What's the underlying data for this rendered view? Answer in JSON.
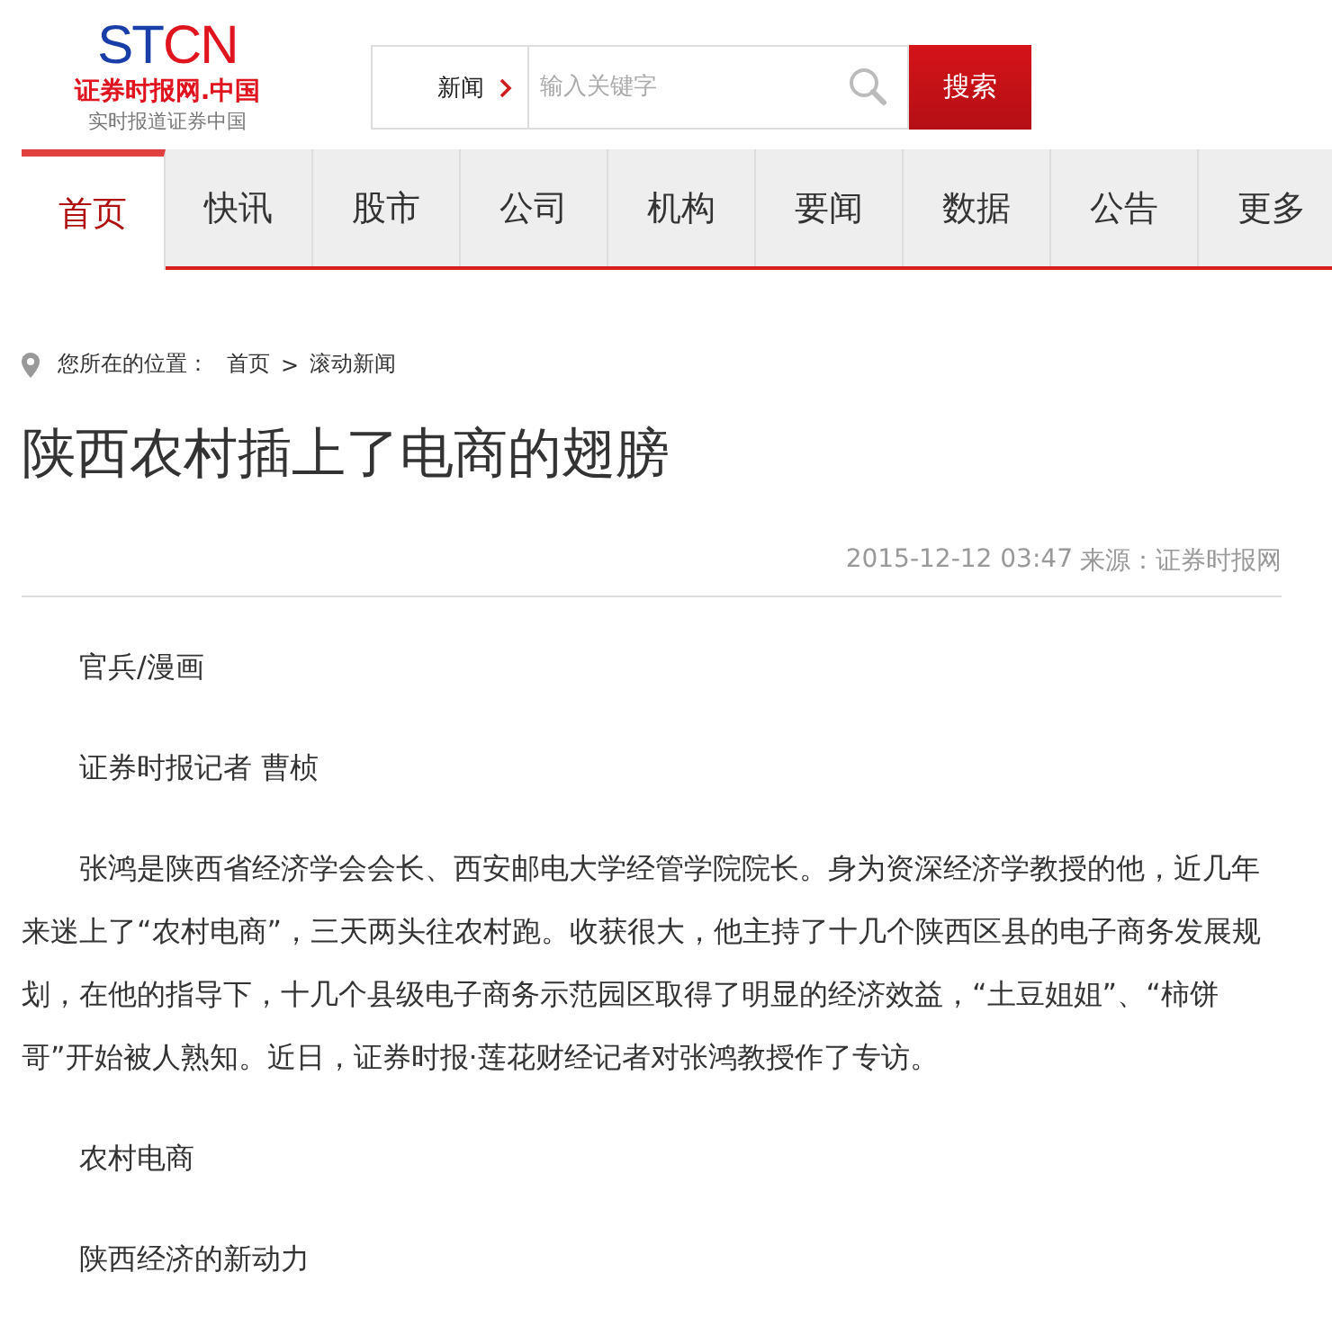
{
  "logo": {
    "mark_parts": [
      {
        "text": "ST",
        "color": "#1a3ea8"
      },
      {
        "text": "CN",
        "color": "#e0141e"
      }
    ],
    "name": "证券时报网.中国",
    "slogan": "实时报道证券中国"
  },
  "search": {
    "category": "新闻",
    "placeholder": "输入关键字",
    "button": "搜索"
  },
  "nav": [
    {
      "label": "首页",
      "selected": true
    },
    {
      "label": "快讯",
      "selected": false
    },
    {
      "label": "股市",
      "selected": false
    },
    {
      "label": "公司",
      "selected": false
    },
    {
      "label": "机构",
      "selected": false
    },
    {
      "label": "要闻",
      "selected": false
    },
    {
      "label": "数据",
      "selected": false
    },
    {
      "label": "公告",
      "selected": false
    },
    {
      "label": "更多",
      "selected": false
    }
  ],
  "breadcrumb": {
    "label": "您所在的位置：",
    "links": [
      "首页",
      "滚动新闻"
    ],
    "separator": ">"
  },
  "article": {
    "title": "陕西农村插上了电商的翅膀",
    "datetime": "2015-12-12 03:47",
    "source": "来源：证券时报网",
    "paragraphs": [
      "官兵/漫画",
      "证券时报记者 曹桢",
      "张鸿是陕西省经济学会会长、西安邮电大学经管学院院长。身为资深经济学教授的他，近几年来迷上了“农村电商”，三天两头往农村跑。收获很大，他主持了十几个陕西区县的电子商务发展规划，在他的指导下，十几个县级电子商务示范园区取得了明显的经济效益，“土豆姐姐”、“柿饼哥”开始被人熟知。近日，证券时报·莲花财经记者对张鸿教授作了专访。",
      "农村电商",
      "陕西经济的新动力"
    ]
  }
}
